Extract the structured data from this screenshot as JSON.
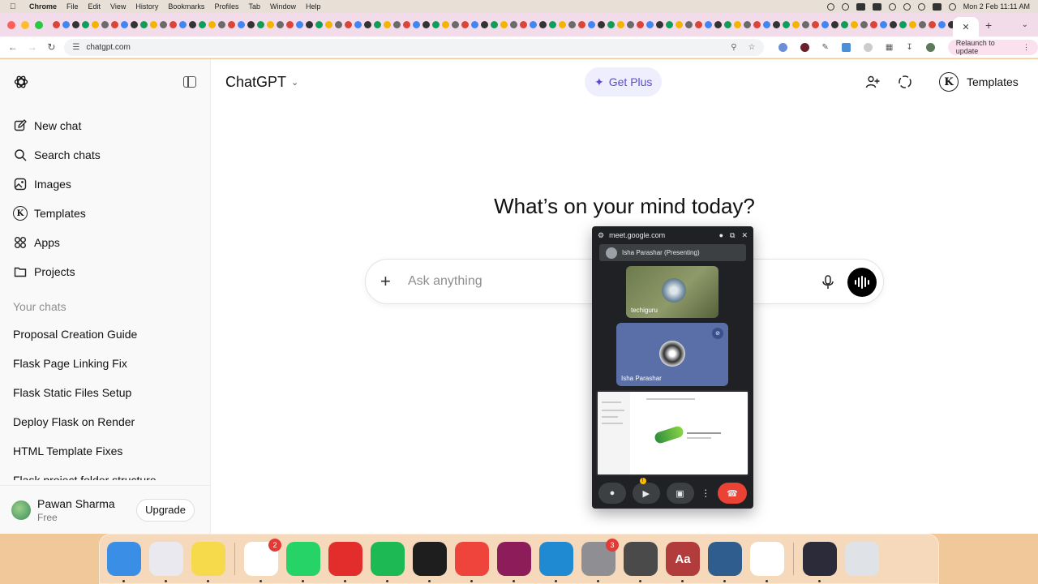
{
  "menubar": {
    "app": "Chrome",
    "items": [
      "File",
      "Edit",
      "View",
      "History",
      "Bookmarks",
      "Profiles",
      "Tab",
      "Window",
      "Help"
    ],
    "datetime": "Mon 2 Feb  11:11 AM"
  },
  "browser": {
    "url": "chatgpt.com",
    "relaunch": "Relaunch to update"
  },
  "sidebar": {
    "nav": [
      {
        "label": "New chat",
        "icon": "edit-icon"
      },
      {
        "label": "Search chats",
        "icon": "search-icon"
      },
      {
        "label": "Images",
        "icon": "image-icon"
      },
      {
        "label": "Templates",
        "icon": "k-icon"
      },
      {
        "label": "Apps",
        "icon": "apps-icon"
      },
      {
        "label": "Projects",
        "icon": "folder-icon"
      }
    ],
    "section_label": "Your chats",
    "chats": [
      "Proposal Creation Guide",
      "Flask Page Linking Fix",
      "Flask Static Files Setup",
      "Deploy Flask on Render",
      "HTML Template Fixes",
      "Flask project folder structure"
    ],
    "user": {
      "name": "Pawan Sharma",
      "plan": "Free",
      "upgrade": "Upgrade"
    }
  },
  "header": {
    "model": "ChatGPT",
    "get_plus": "Get Plus",
    "templates": "Templates",
    "templates_badge": "K"
  },
  "main": {
    "headline": "What’s on your mind today?",
    "placeholder": "Ask anything"
  },
  "meet": {
    "domain": "meet.google.com",
    "presenting": "Isha Parashar (Presenting)",
    "participants": [
      "techiguru",
      "Isha Parashar"
    ]
  },
  "dock": {
    "apps": [
      {
        "name": "Finder",
        "color": "#3a8ee6"
      },
      {
        "name": "Launchpad",
        "color": "#e9e9ef"
      },
      {
        "name": "Notes",
        "color": "#f7d94c"
      },
      {
        "name": "Chrome",
        "color": "#ffffff",
        "badge": "2"
      },
      {
        "name": "WhatsApp",
        "color": "#25d366"
      },
      {
        "name": "WPS Office",
        "color": "#e32d2d"
      },
      {
        "name": "Spotify",
        "color": "#1db954"
      },
      {
        "name": "Terminal",
        "color": "#1e1e1e"
      },
      {
        "name": "AnyDesk",
        "color": "#ef443b"
      },
      {
        "name": "RAR Extractor",
        "color": "#8c1d5a"
      },
      {
        "name": "VS Code",
        "color": "#1f8ad2"
      },
      {
        "name": "System Settings",
        "color": "#8e8e93",
        "badge": "3"
      },
      {
        "name": "Calculator",
        "color": "#4a4a4a"
      },
      {
        "name": "Dictionary",
        "color": "#b23b3b"
      },
      {
        "name": "MySQL Workbench",
        "color": "#2f5e8e"
      },
      {
        "name": "MongoDB Compass",
        "color": "#ffffff"
      },
      {
        "name": "OBS Studio",
        "color": "#2b2b3a"
      }
    ],
    "dictionary_glyph": "Aa"
  }
}
